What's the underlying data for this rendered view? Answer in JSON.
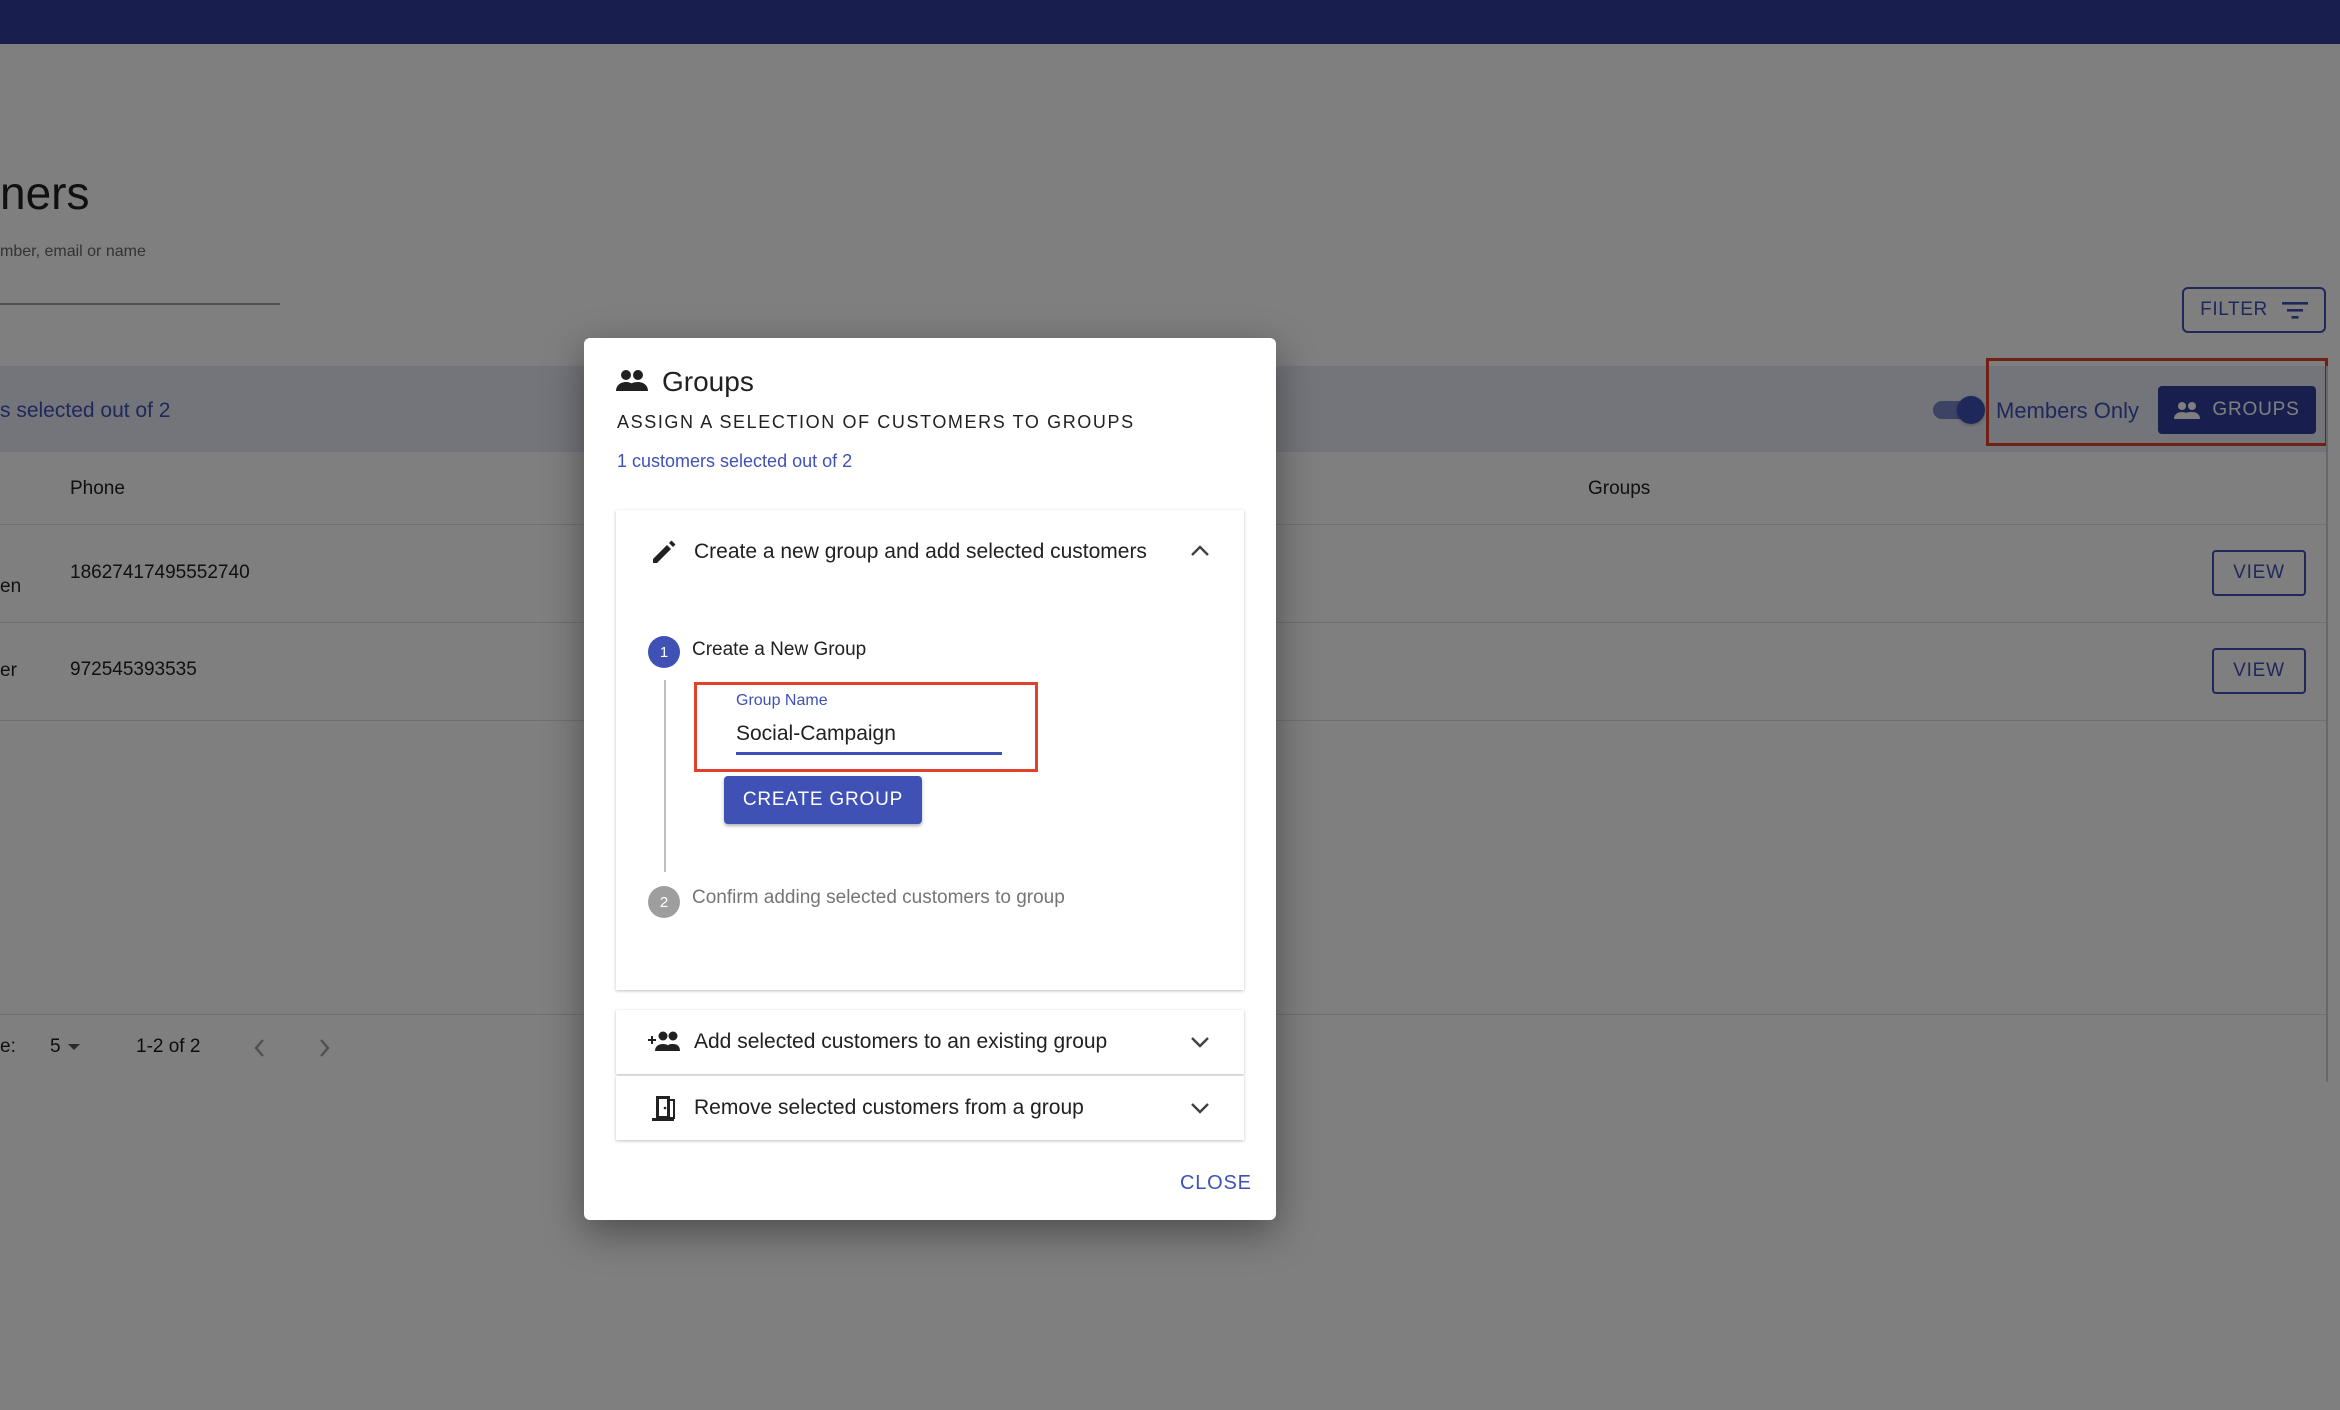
{
  "background": {
    "page_title": "ners",
    "search_label": "mber, email or name",
    "filter_label": "FILTER",
    "selection_text": "s selected out of 2",
    "members_only_label": "Members Only",
    "groups_button_label": "GROUPS",
    "table": {
      "headers": {
        "phone": "Phone",
        "groups": "Groups"
      },
      "rows": [
        {
          "name_fragment": "en",
          "phone": "18627417495552740",
          "action": "VIEW"
        },
        {
          "name_fragment": "er",
          "phone": "972545393535",
          "action": "VIEW"
        }
      ]
    },
    "pagination": {
      "rows_per_page_label": "e:",
      "rows_per_page_value": "5",
      "range": "1-2 of 2"
    }
  },
  "dialog": {
    "title": "Groups",
    "subtitle": "ASSIGN A SELECTION OF CUSTOMERS TO GROUPS",
    "selected_count": "1 customers selected out of 2",
    "panels": [
      {
        "label": "Create a new group and add selected customers",
        "icon": "pencil-icon",
        "expanded": true
      },
      {
        "label": "Add selected customers to an existing group",
        "icon": "group-add-icon",
        "expanded": false
      },
      {
        "label": "Remove selected customers from a group",
        "icon": "door-exit-icon",
        "expanded": false
      }
    ],
    "steps": [
      {
        "number": "1",
        "label": "Create a New Group"
      },
      {
        "number": "2",
        "label": "Confirm adding selected customers to group"
      }
    ],
    "group_name": {
      "label": "Group Name",
      "value": "Social-Campaign"
    },
    "create_button": "CREATE GROUP",
    "close_button": "CLOSE"
  },
  "colors": {
    "primary": "#3f51b5",
    "appbar": "#303f9f",
    "highlight": "#e0412b"
  }
}
